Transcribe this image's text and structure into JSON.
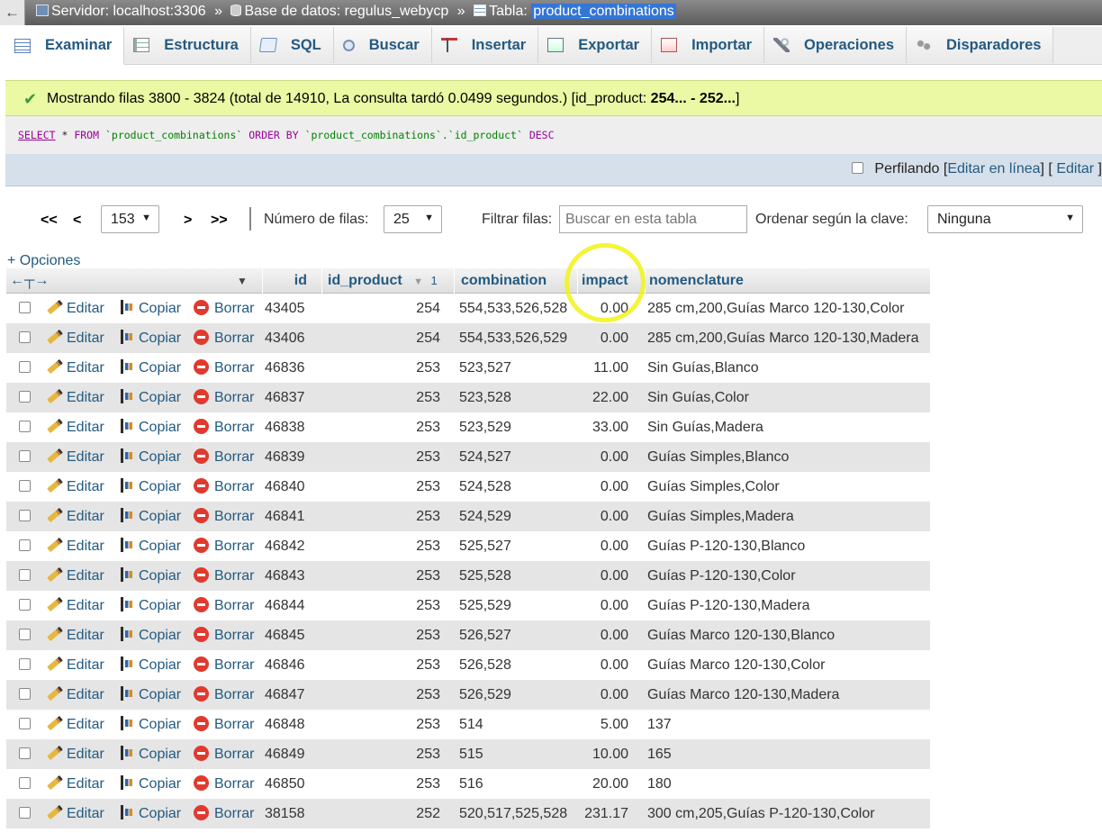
{
  "breadcrumb": {
    "back_glyph": "←",
    "server_label": "Servidor: localhost:3306",
    "database_label": "Base de datos: regulus_webycp",
    "table_prefix": "Tabla:",
    "table_name": "product_combinations",
    "separator": "»"
  },
  "tabs": [
    {
      "label": "Examinar",
      "icon": "browse-icon",
      "active": true
    },
    {
      "label": "Estructura",
      "icon": "structure-icon"
    },
    {
      "label": "SQL",
      "icon": "sql-icon"
    },
    {
      "label": "Buscar",
      "icon": "search-icon"
    },
    {
      "label": "Insertar",
      "icon": "insert-icon"
    },
    {
      "label": "Exportar",
      "icon": "export-icon"
    },
    {
      "label": "Importar",
      "icon": "import-icon"
    },
    {
      "label": "Operaciones",
      "icon": "operations-icon"
    },
    {
      "label": "Disparadores",
      "icon": "triggers-icon"
    }
  ],
  "message": {
    "text_prefix": "Mostrando filas 3800 - 3824 (total de 14910, La consulta tardó 0.0499 segundos.) [id_product: ",
    "range_bold": "254... - 252...",
    "text_suffix": "]"
  },
  "sql": {
    "select_kw": "SELECT",
    "rest_1": " * ",
    "from_kw": "FROM",
    "table_quoted": "`product_combinations`",
    "order_kw": "ORDER BY",
    "col_quoted": "`product_combinations`.`id_product`",
    "desc_kw": "DESC"
  },
  "profiling": {
    "label": "Perfilando",
    "edit_inline": "Editar en línea",
    "edit": "Editar"
  },
  "nav": {
    "first": "<<",
    "prev": "<",
    "page": "153",
    "next": ">",
    "last": ">>",
    "rows_label": "Número de filas:",
    "rows_value": "25",
    "filter_label": "Filtrar filas:",
    "filter_placeholder": "Buscar en esta tabla",
    "sort_label": "Ordenar según la clave:",
    "sort_value": "Ninguna"
  },
  "options_link": "+ Opciones",
  "table": {
    "columns": {
      "id": "id",
      "id_product": "id_product",
      "sort_index": "1",
      "combination": "combination",
      "impact": "impact",
      "nomenclature": "nomenclature"
    },
    "actions": {
      "edit": "Editar",
      "copy": "Copiar",
      "delete": "Borrar"
    },
    "rows": [
      {
        "id": "43405",
        "id_product": "254",
        "combination": "554,533,526,528",
        "impact": "0.00",
        "nomenclature": "285 cm,200,Guías Marco 120-130,Color"
      },
      {
        "id": "43406",
        "id_product": "254",
        "combination": "554,533,526,529",
        "impact": "0.00",
        "nomenclature": "285 cm,200,Guías Marco 120-130,Madera"
      },
      {
        "id": "46836",
        "id_product": "253",
        "combination": "523,527",
        "impact": "11.00",
        "nomenclature": "Sin Guías,Blanco"
      },
      {
        "id": "46837",
        "id_product": "253",
        "combination": "523,528",
        "impact": "22.00",
        "nomenclature": "Sin Guías,Color"
      },
      {
        "id": "46838",
        "id_product": "253",
        "combination": "523,529",
        "impact": "33.00",
        "nomenclature": "Sin Guías,Madera"
      },
      {
        "id": "46839",
        "id_product": "253",
        "combination": "524,527",
        "impact": "0.00",
        "nomenclature": "Guías Simples,Blanco"
      },
      {
        "id": "46840",
        "id_product": "253",
        "combination": "524,528",
        "impact": "0.00",
        "nomenclature": "Guías Simples,Color"
      },
      {
        "id": "46841",
        "id_product": "253",
        "combination": "524,529",
        "impact": "0.00",
        "nomenclature": "Guías Simples,Madera"
      },
      {
        "id": "46842",
        "id_product": "253",
        "combination": "525,527",
        "impact": "0.00",
        "nomenclature": "Guías P-120-130,Blanco"
      },
      {
        "id": "46843",
        "id_product": "253",
        "combination": "525,528",
        "impact": "0.00",
        "nomenclature": "Guías P-120-130,Color"
      },
      {
        "id": "46844",
        "id_product": "253",
        "combination": "525,529",
        "impact": "0.00",
        "nomenclature": "Guías P-120-130,Madera"
      },
      {
        "id": "46845",
        "id_product": "253",
        "combination": "526,527",
        "impact": "0.00",
        "nomenclature": "Guías Marco 120-130,Blanco"
      },
      {
        "id": "46846",
        "id_product": "253",
        "combination": "526,528",
        "impact": "0.00",
        "nomenclature": "Guías Marco 120-130,Color"
      },
      {
        "id": "46847",
        "id_product": "253",
        "combination": "526,529",
        "impact": "0.00",
        "nomenclature": "Guías Marco 120-130,Madera"
      },
      {
        "id": "46848",
        "id_product": "253",
        "combination": "514",
        "impact": "5.00",
        "nomenclature": "137"
      },
      {
        "id": "46849",
        "id_product": "253",
        "combination": "515",
        "impact": "10.00",
        "nomenclature": "165"
      },
      {
        "id": "46850",
        "id_product": "253",
        "combination": "516",
        "impact": "20.00",
        "nomenclature": "180"
      },
      {
        "id": "38158",
        "id_product": "252",
        "combination": "520,517,525,528",
        "impact": "231.17",
        "nomenclature": "300 cm,205,Guías P-120-130,Color"
      }
    ]
  },
  "colors": {
    "link": "#235a81",
    "success_bg": "#ebf8a4",
    "row_alt": "#e5e5e5",
    "highlight_circle": "#f2f21a"
  }
}
